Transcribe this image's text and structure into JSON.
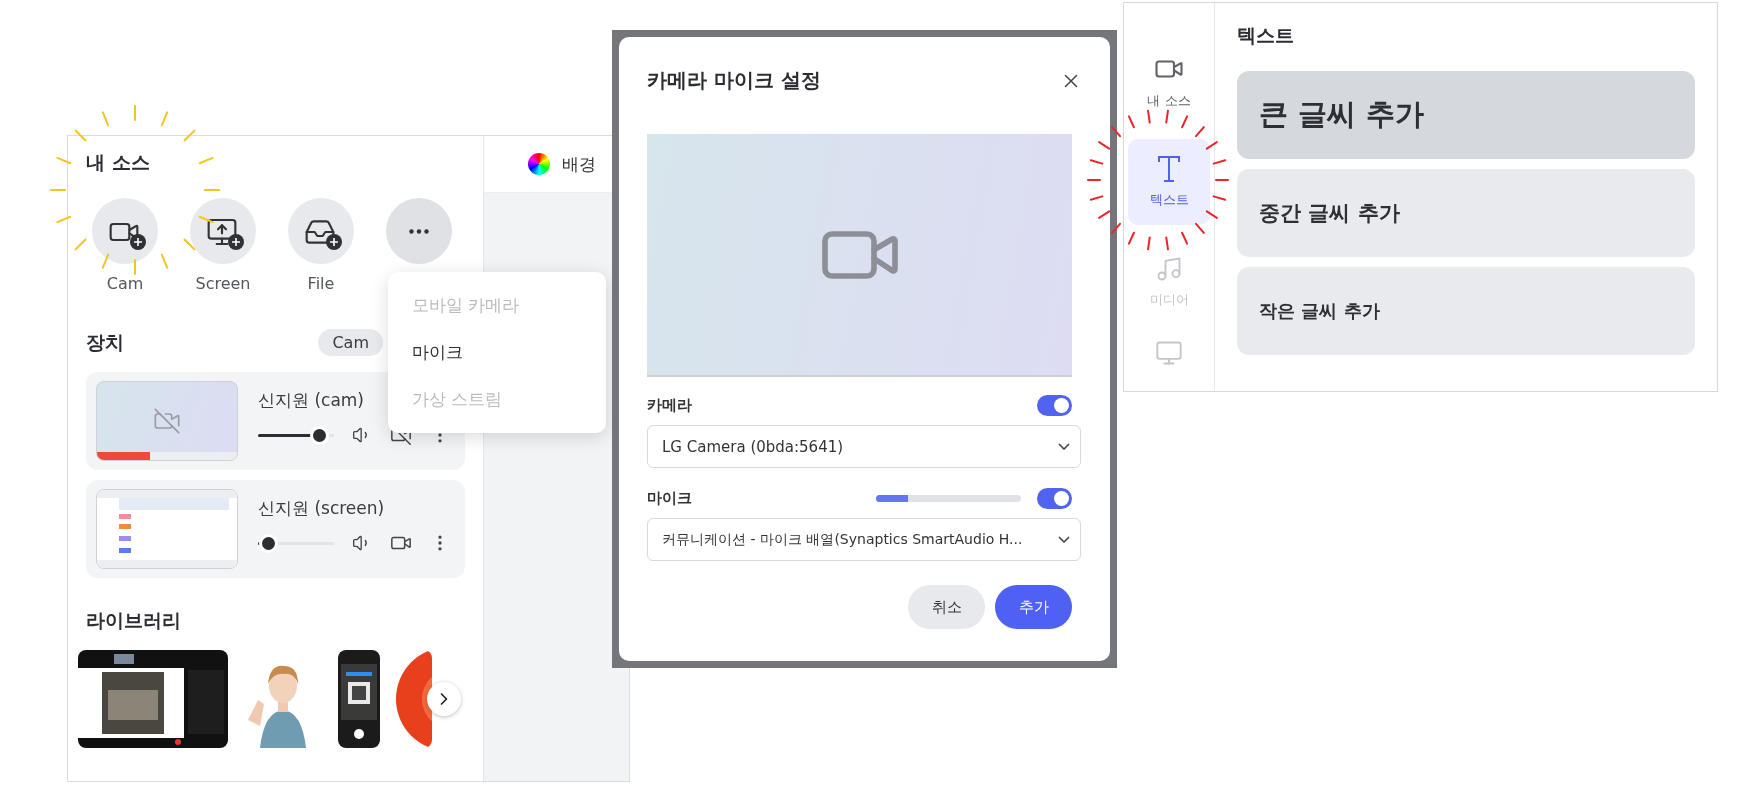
{
  "left_panel": {
    "title": "내 소스",
    "source_buttons": [
      {
        "kind": "cam",
        "label": "Cam"
      },
      {
        "kind": "screen",
        "label": "Screen"
      },
      {
        "kind": "file",
        "label": "File"
      },
      {
        "kind": "more"
      }
    ],
    "more_menu": [
      {
        "label": "모바일 카메라",
        "disabled": true
      },
      {
        "label": "마이크",
        "disabled": false
      },
      {
        "label": "가상 스트림",
        "disabled": true
      }
    ],
    "devices_title": "장치",
    "device_filter": "Cam",
    "devices": [
      {
        "name": "신지원 (cam)",
        "kind": "cam",
        "level": 0.82,
        "camera_on": false,
        "meter": {
          "level": 0.38
        }
      },
      {
        "name": "신지원 (screen)",
        "kind": "screen",
        "level": 0.15,
        "camera_on": true
      }
    ],
    "library_title": "라이브러리",
    "canvas_tab": "배경"
  },
  "dialog": {
    "title": "카메라 마이크 설정",
    "camera": {
      "label": "카메라",
      "on": true,
      "device": "LG Camera (0bda:5641)"
    },
    "mic": {
      "label": "마이크",
      "on": true,
      "level": 0.22,
      "device": "커뮤니케이션 - 마이크 배열(Synaptics SmartAudio H..."
    },
    "buttons": [
      {
        "label": "취소",
        "kind": "secondary"
      },
      {
        "label": "추가",
        "kind": "primary"
      }
    ]
  },
  "text_panel": {
    "sidebar": [
      {
        "label": "내 소스",
        "kind": "camera",
        "selected": false,
        "disabled": false
      },
      {
        "label": "텍스트",
        "kind": "text",
        "selected": true,
        "disabled": false
      },
      {
        "label": "미디어",
        "kind": "media",
        "selected": false,
        "disabled": true
      }
    ],
    "title": "텍스트",
    "options": [
      {
        "label": "큰 글씨 추가",
        "kind": "large",
        "selected": true
      },
      {
        "label": "중간 글씨 추가",
        "kind": "medium",
        "selected": false
      },
      {
        "label": "작은 글씨 추가",
        "kind": "small",
        "selected": false
      }
    ]
  }
}
